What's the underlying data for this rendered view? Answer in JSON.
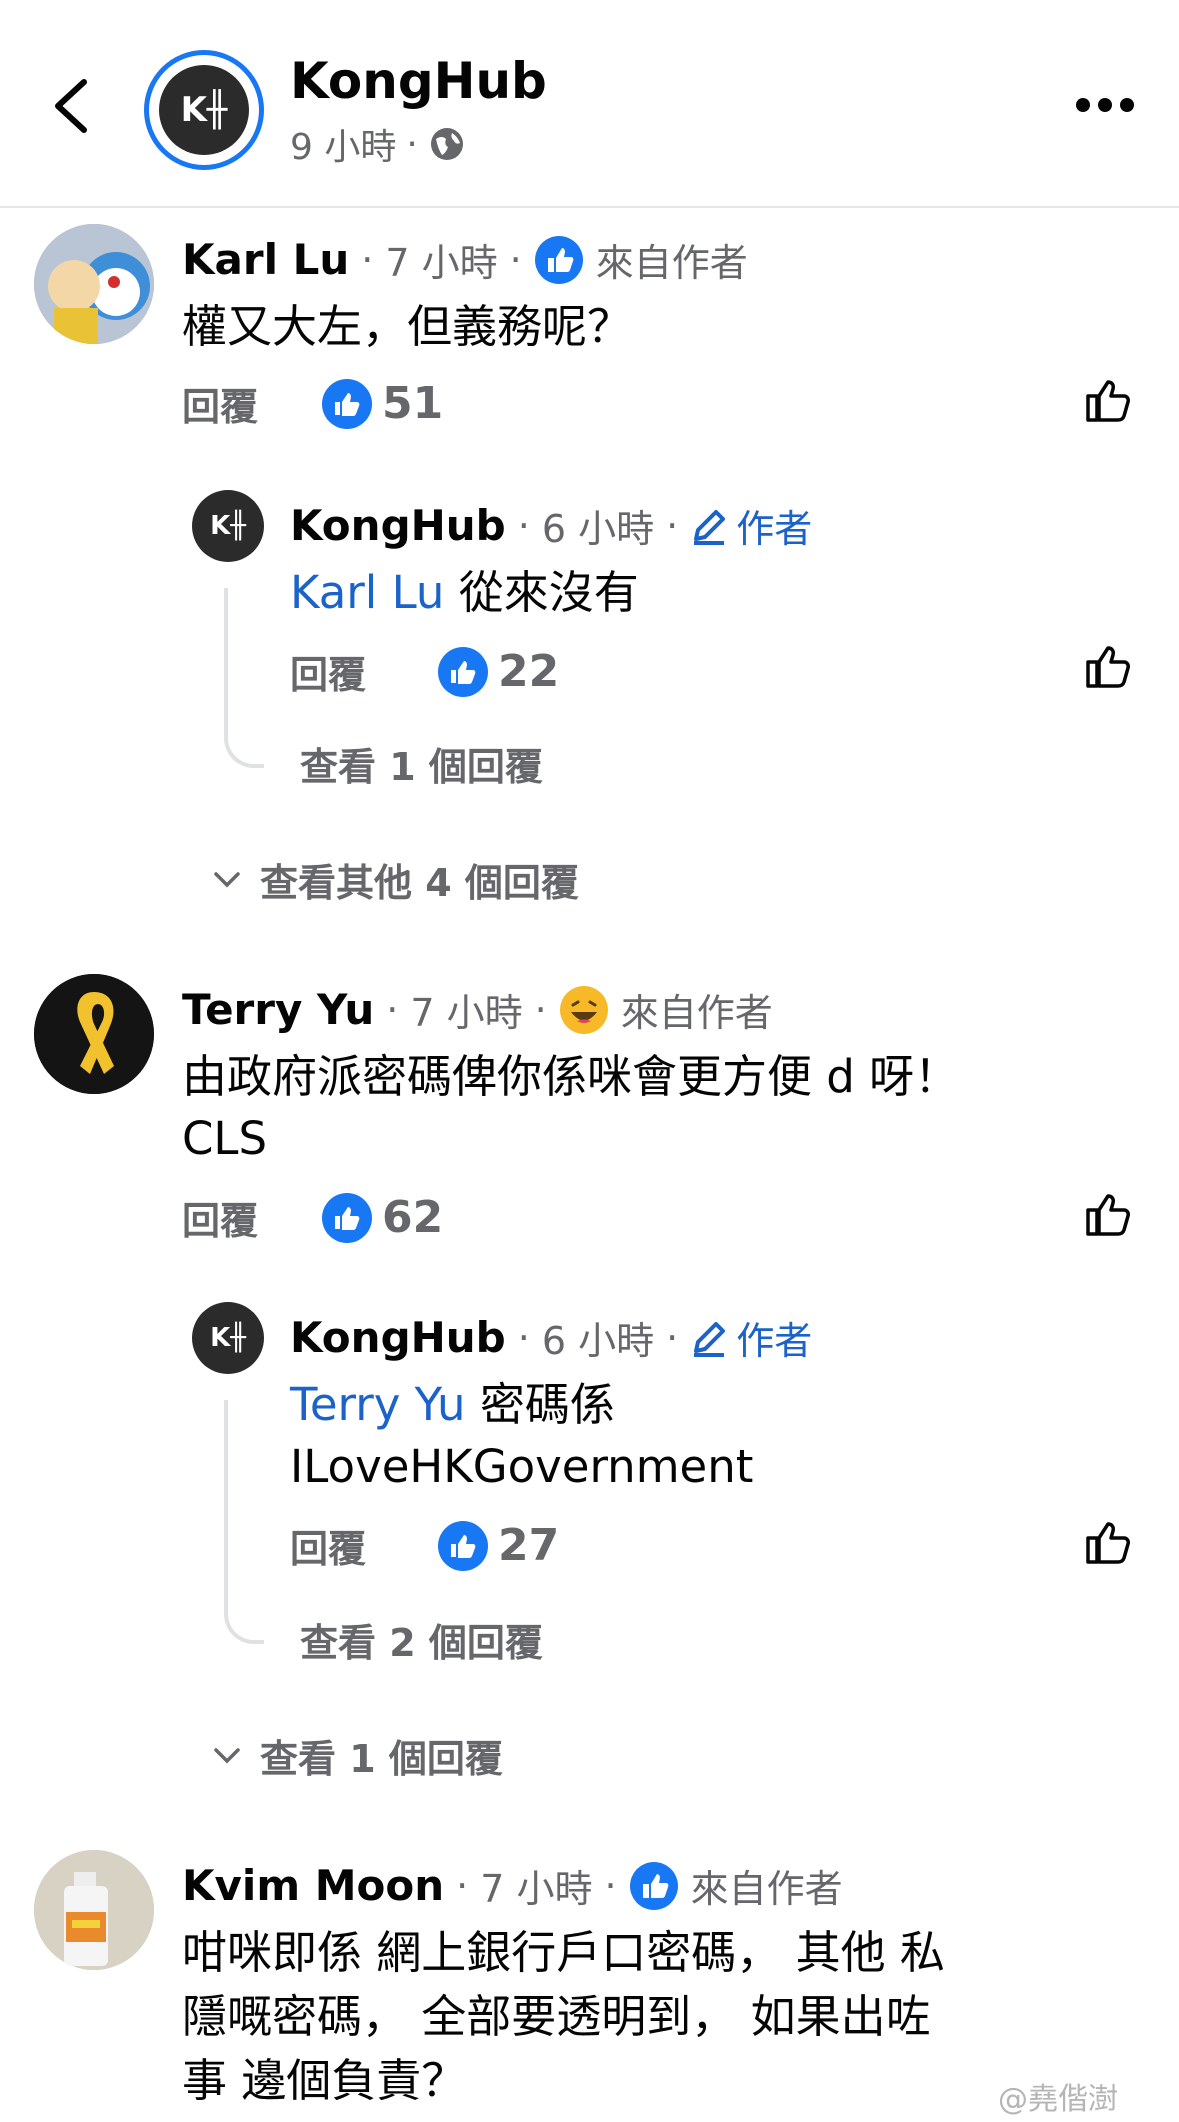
{
  "header": {
    "title": "KongHub",
    "time": "9 小時",
    "dot": "·"
  },
  "comments": [
    {
      "name": "Karl Lu",
      "time": "7 小時",
      "badge": "來自作者",
      "text": "權又大左，但義務呢？",
      "reply_label": "回覆",
      "likes": "51",
      "reply": {
        "name": "KongHub",
        "time": "6 小時",
        "badge": "作者",
        "mention": "Karl Lu",
        "text": " 從來沒有",
        "reply_label": "回覆",
        "likes": "22",
        "view_replies": "查看 1 個回覆"
      },
      "more_replies": "查看其他 4 個回覆"
    },
    {
      "name": "Terry Yu",
      "time": "7 小時",
      "badge": "來自作者",
      "text_line1": "由政府派密碼俾你係咪會更方便 d 呀！",
      "text_line2": "CLS",
      "reply_label": "回覆",
      "likes": "62",
      "reply": {
        "name": "KongHub",
        "time": "6 小時",
        "badge": "作者",
        "mention": "Terry Yu",
        "text_line1": " 密碼係",
        "text_line2": "ILoveHKGovernment",
        "reply_label": "回覆",
        "likes": "27",
        "view_replies": "查看 2 個回覆"
      },
      "more_replies": "查看 1 個回覆"
    },
    {
      "name": "Kvim Moon",
      "time": "7 小時",
      "badge": "來自作者",
      "text_line1": "咁咪即係 網上銀行戶口密碼，  其他 私",
      "text_line2": "隱嘅密碼，  全部要透明到，  如果出咗",
      "text_line3": "事 邊個負責？"
    }
  ],
  "meta_dot": "·",
  "watermark": "@堯偕澍",
  "colors": {
    "accent": "#1877f2",
    "mention": "#1b62c9",
    "muted": "#65676b"
  }
}
